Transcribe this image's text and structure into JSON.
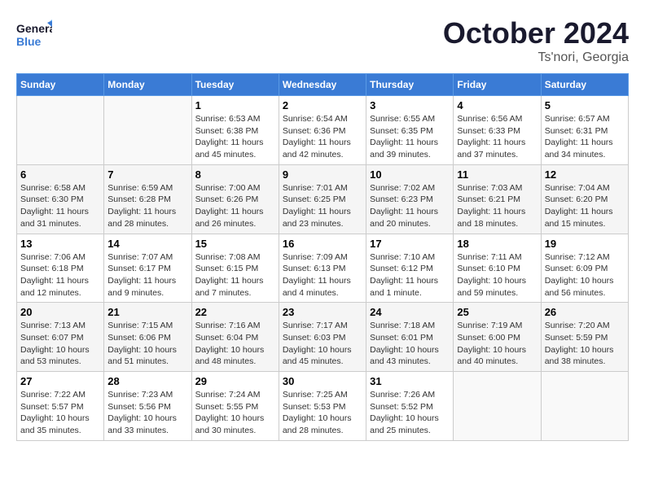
{
  "header": {
    "logo_general": "General",
    "logo_blue": "Blue",
    "month": "October 2024",
    "location": "Ts'nori, Georgia"
  },
  "days_of_week": [
    "Sunday",
    "Monday",
    "Tuesday",
    "Wednesday",
    "Thursday",
    "Friday",
    "Saturday"
  ],
  "weeks": [
    [
      {
        "day": "",
        "empty": true
      },
      {
        "day": "",
        "empty": true
      },
      {
        "day": "1",
        "sunrise": "6:53 AM",
        "sunset": "6:38 PM",
        "daylight": "11 hours and 45 minutes."
      },
      {
        "day": "2",
        "sunrise": "6:54 AM",
        "sunset": "6:36 PM",
        "daylight": "11 hours and 42 minutes."
      },
      {
        "day": "3",
        "sunrise": "6:55 AM",
        "sunset": "6:35 PM",
        "daylight": "11 hours and 39 minutes."
      },
      {
        "day": "4",
        "sunrise": "6:56 AM",
        "sunset": "6:33 PM",
        "daylight": "11 hours and 37 minutes."
      },
      {
        "day": "5",
        "sunrise": "6:57 AM",
        "sunset": "6:31 PM",
        "daylight": "11 hours and 34 minutes."
      }
    ],
    [
      {
        "day": "6",
        "sunrise": "6:58 AM",
        "sunset": "6:30 PM",
        "daylight": "11 hours and 31 minutes."
      },
      {
        "day": "7",
        "sunrise": "6:59 AM",
        "sunset": "6:28 PM",
        "daylight": "11 hours and 28 minutes."
      },
      {
        "day": "8",
        "sunrise": "7:00 AM",
        "sunset": "6:26 PM",
        "daylight": "11 hours and 26 minutes."
      },
      {
        "day": "9",
        "sunrise": "7:01 AM",
        "sunset": "6:25 PM",
        "daylight": "11 hours and 23 minutes."
      },
      {
        "day": "10",
        "sunrise": "7:02 AM",
        "sunset": "6:23 PM",
        "daylight": "11 hours and 20 minutes."
      },
      {
        "day": "11",
        "sunrise": "7:03 AM",
        "sunset": "6:21 PM",
        "daylight": "11 hours and 18 minutes."
      },
      {
        "day": "12",
        "sunrise": "7:04 AM",
        "sunset": "6:20 PM",
        "daylight": "11 hours and 15 minutes."
      }
    ],
    [
      {
        "day": "13",
        "sunrise": "7:06 AM",
        "sunset": "6:18 PM",
        "daylight": "11 hours and 12 minutes."
      },
      {
        "day": "14",
        "sunrise": "7:07 AM",
        "sunset": "6:17 PM",
        "daylight": "11 hours and 9 minutes."
      },
      {
        "day": "15",
        "sunrise": "7:08 AM",
        "sunset": "6:15 PM",
        "daylight": "11 hours and 7 minutes."
      },
      {
        "day": "16",
        "sunrise": "7:09 AM",
        "sunset": "6:13 PM",
        "daylight": "11 hours and 4 minutes."
      },
      {
        "day": "17",
        "sunrise": "7:10 AM",
        "sunset": "6:12 PM",
        "daylight": "11 hours and 1 minute."
      },
      {
        "day": "18",
        "sunrise": "7:11 AM",
        "sunset": "6:10 PM",
        "daylight": "10 hours and 59 minutes."
      },
      {
        "day": "19",
        "sunrise": "7:12 AM",
        "sunset": "6:09 PM",
        "daylight": "10 hours and 56 minutes."
      }
    ],
    [
      {
        "day": "20",
        "sunrise": "7:13 AM",
        "sunset": "6:07 PM",
        "daylight": "10 hours and 53 minutes."
      },
      {
        "day": "21",
        "sunrise": "7:15 AM",
        "sunset": "6:06 PM",
        "daylight": "10 hours and 51 minutes."
      },
      {
        "day": "22",
        "sunrise": "7:16 AM",
        "sunset": "6:04 PM",
        "daylight": "10 hours and 48 minutes."
      },
      {
        "day": "23",
        "sunrise": "7:17 AM",
        "sunset": "6:03 PM",
        "daylight": "10 hours and 45 minutes."
      },
      {
        "day": "24",
        "sunrise": "7:18 AM",
        "sunset": "6:01 PM",
        "daylight": "10 hours and 43 minutes."
      },
      {
        "day": "25",
        "sunrise": "7:19 AM",
        "sunset": "6:00 PM",
        "daylight": "10 hours and 40 minutes."
      },
      {
        "day": "26",
        "sunrise": "7:20 AM",
        "sunset": "5:59 PM",
        "daylight": "10 hours and 38 minutes."
      }
    ],
    [
      {
        "day": "27",
        "sunrise": "7:22 AM",
        "sunset": "5:57 PM",
        "daylight": "10 hours and 35 minutes."
      },
      {
        "day": "28",
        "sunrise": "7:23 AM",
        "sunset": "5:56 PM",
        "daylight": "10 hours and 33 minutes."
      },
      {
        "day": "29",
        "sunrise": "7:24 AM",
        "sunset": "5:55 PM",
        "daylight": "10 hours and 30 minutes."
      },
      {
        "day": "30",
        "sunrise": "7:25 AM",
        "sunset": "5:53 PM",
        "daylight": "10 hours and 28 minutes."
      },
      {
        "day": "31",
        "sunrise": "7:26 AM",
        "sunset": "5:52 PM",
        "daylight": "10 hours and 25 minutes."
      },
      {
        "day": "",
        "empty": true
      },
      {
        "day": "",
        "empty": true
      }
    ]
  ]
}
